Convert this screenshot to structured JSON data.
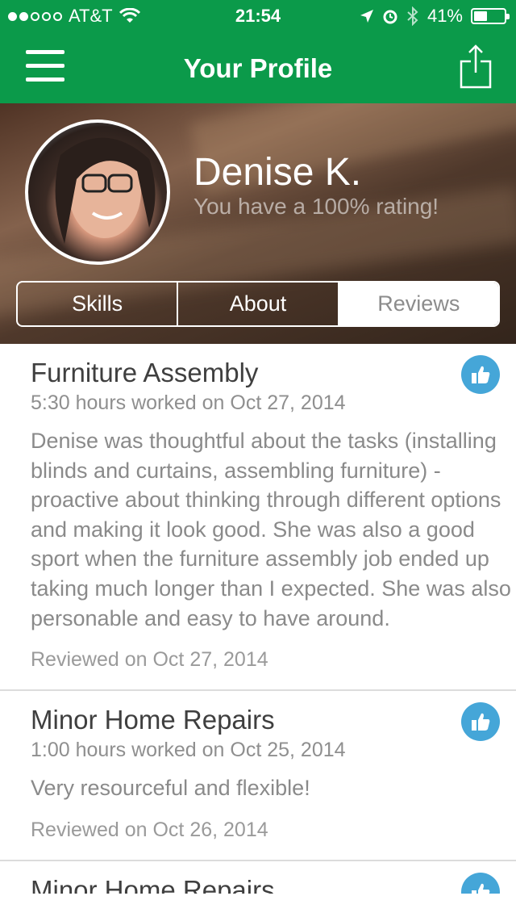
{
  "status_bar": {
    "carrier": "AT&T",
    "time": "21:54",
    "battery": "41%",
    "signal_filled": 2,
    "signal_total": 5
  },
  "nav": {
    "title": "Your Profile",
    "menu_icon": "hamburger-menu-icon",
    "share_icon": "share-icon"
  },
  "profile": {
    "name": "Denise K.",
    "rating_text": "You have a 100% rating!"
  },
  "tabs": [
    {
      "label": "Skills",
      "active": false
    },
    {
      "label": "About",
      "active": false
    },
    {
      "label": "Reviews",
      "active": true
    }
  ],
  "reviews": [
    {
      "title": "Furniture Assembly",
      "meta": "5:30 hours worked on Oct 27, 2014",
      "text": "Denise was thoughtful about the tasks (installing blinds and curtains, assembling furniture) - proactive about thinking through different options and making it look good. She was also a good sport when the furniture assembly job ended up taking much longer than I expected. She was also personable and easy to have around.",
      "reviewed": "Reviewed on Oct 27, 2014"
    },
    {
      "title": "Minor Home Repairs",
      "meta": "1:00 hours worked on Oct 25, 2014",
      "text": "Very resourceful and flexible!",
      "reviewed": "Reviewed on Oct 26, 2014"
    },
    {
      "title": "Minor Home Repairs"
    }
  ],
  "colors": {
    "brand_green": "#0b9a4a",
    "thumb_blue": "#45a6d8"
  }
}
